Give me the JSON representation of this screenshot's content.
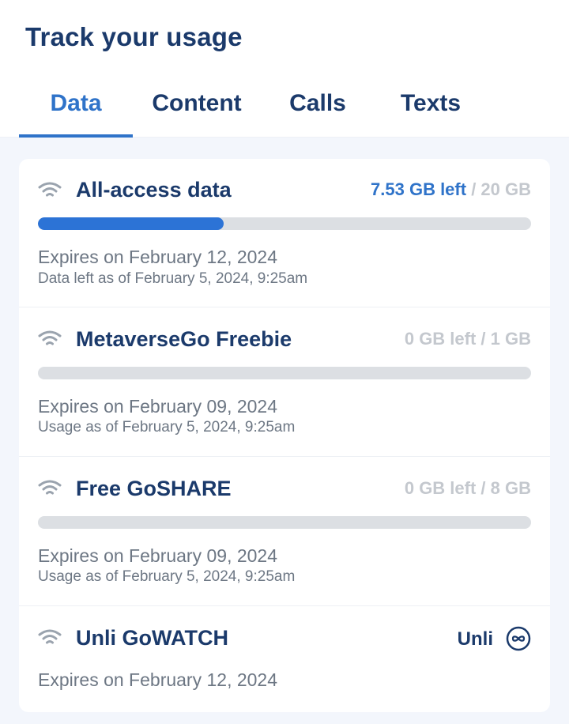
{
  "page": {
    "title": "Track your usage"
  },
  "tabs": [
    {
      "label": "Data",
      "active": true
    },
    {
      "label": "Content",
      "active": false
    },
    {
      "label": "Calls",
      "active": false
    },
    {
      "label": "Texts",
      "active": false
    }
  ],
  "colors": {
    "accent": "#2f73c9",
    "title": "#1b3a6b",
    "muted": "#c4c8ce",
    "bar_track": "#dcdfe3",
    "bar_fill": "#2c73d6"
  },
  "items": [
    {
      "name": "All-access data",
      "icon": "wifi-icon",
      "left": "7.53 GB left",
      "total": " / 20 GB",
      "progress_fraction": 0.3765,
      "expires": "Expires on February 12, 2024",
      "asof": "Data left as of February 5, 2024, 9:25am"
    },
    {
      "name": "MetaverseGo Freebie",
      "icon": "wifi-icon",
      "left": "0 GB left",
      "total": " / 1 GB",
      "progress_fraction": 0,
      "expires": "Expires on February 09, 2024",
      "asof": "Usage as of February 5, 2024, 9:25am"
    },
    {
      "name": "Free GoSHARE",
      "icon": "wifi-icon",
      "left": "0 GB left",
      "total": " / 8 GB",
      "progress_fraction": 0,
      "expires": "Expires on February 09, 2024",
      "asof": "Usage as of February 5, 2024, 9:25am"
    },
    {
      "name": "Unli GoWATCH",
      "icon": "wifi-icon",
      "unli": "Unli",
      "unli_icon": "infinity-icon",
      "expires": "Expires on February 12, 2024"
    }
  ]
}
